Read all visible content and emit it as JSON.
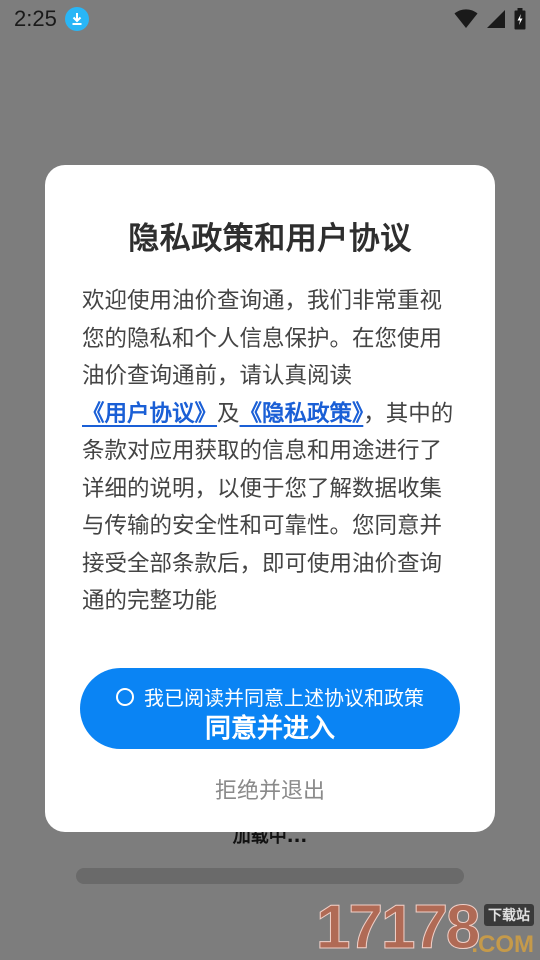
{
  "status_bar": {
    "time": "2:25",
    "icons": [
      "download-icon",
      "wifi-icon",
      "cellular-signal-icon",
      "battery-icon"
    ]
  },
  "background": {
    "loading_text": "加载中..."
  },
  "dialog": {
    "title": "隐私政策和用户协议",
    "body_intro": "欢迎使用油价查询通，我们非常重视您的隐私和个人信息保护。在您使用油价查询通前，请认真阅读",
    "user_agreement_link": "《用户协议》",
    "conjunction": "及",
    "privacy_policy_link": "《隐私政策》",
    "body_rest": "，其中的条款对应用获取的信息和用途进行了详细的说明，以便于您了解数据收集与传输的安全性和可靠性。您同意并接受全部条款后，即可使用油价查询通的完整功能",
    "consent_text": "我已阅读并同意上述协议和政策",
    "consent_checked": false,
    "agree_label": "同意并进入",
    "reject_label": "拒绝并退出"
  },
  "watermark": {
    "number": "17178",
    "badge": "下载站",
    "domain": ".COM"
  },
  "colors": {
    "primary_button": "#0a84f4",
    "link": "#1a5fd6",
    "overlay": "#7d7d7d"
  }
}
